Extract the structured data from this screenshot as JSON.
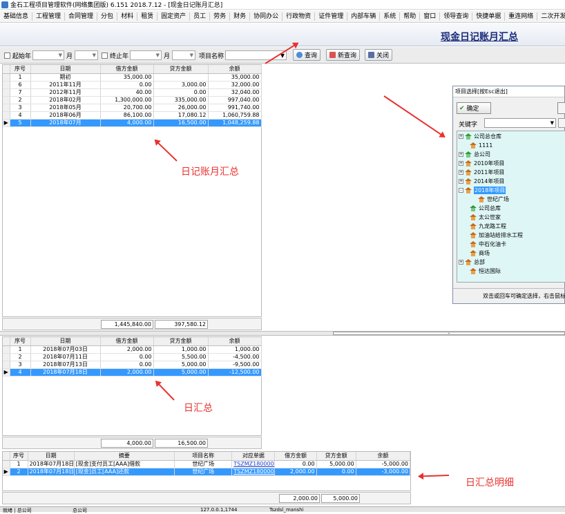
{
  "window": {
    "title": "金石工程项目管理软件(网络集团版) 6.151  2018.7.12 - [现金日记账月汇总]"
  },
  "menu": [
    "基础信息",
    "工程管理",
    "合同管理",
    "分包",
    "材料",
    "租赁",
    "固定资产",
    "员工",
    "劳务",
    "财务",
    "协同办公",
    "行政物资",
    "证件管理",
    "内部车辆",
    "系统",
    "帮助",
    "窗口",
    "领导查询",
    "快捷单据",
    "重连网络",
    "二次开发"
  ],
  "page_title": "现金日记账月汇总",
  "toolbar": {
    "start_year_label": "起始年",
    "start_month_label": "月",
    "end_year_label": "终止年",
    "end_month_label": "月",
    "project_label": "项目名称",
    "query_btn": "查询",
    "new_query_btn": "新查询",
    "close_btn": "关闭"
  },
  "monthly": {
    "headers": [
      "序号",
      "日期",
      "借方金额",
      "贷方金额",
      "余额"
    ],
    "rows": [
      [
        "1",
        "期初",
        "35,000.00",
        "",
        "35,000.00"
      ],
      [
        "6",
        "2011年11月",
        "0.00",
        "3,000.00",
        "32,000.00"
      ],
      [
        "7",
        "2012年11月",
        "40.00",
        "0.00",
        "32,040.00"
      ],
      [
        "2",
        "2018年02月",
        "1,300,000.00",
        "335,000.00",
        "997,040.00"
      ],
      [
        "3",
        "2018年05月",
        "20,700.00",
        "26,000.00",
        "991,740.00"
      ],
      [
        "4",
        "2018年06月",
        "86,100.00",
        "17,080.12",
        "1,060,759.88"
      ],
      [
        "5",
        "2018年07月",
        "4,000.00",
        "16,500.00",
        "1,048,259.88"
      ]
    ],
    "sum_debit": "1,445,840.00",
    "sum_credit": "397,580.12"
  },
  "daily": {
    "headers": [
      "序号",
      "日期",
      "借方金额",
      "贷方金额",
      "余额"
    ],
    "rows": [
      [
        "1",
        "2018年07月03日",
        "2,000.00",
        "1,000.00",
        "1,000.00"
      ],
      [
        "2",
        "2018年07月11日",
        "0.00",
        "5,500.00",
        "-4,500.00"
      ],
      [
        "3",
        "2018年07月13日",
        "0.00",
        "5,000.00",
        "-9,500.00"
      ],
      [
        "4",
        "2018年07月18日",
        "2,000.00",
        "5,000.00",
        "-12,500.00"
      ]
    ],
    "sum_debit": "4,000.00",
    "sum_credit": "16,500.00"
  },
  "detail": {
    "headers": [
      "序号",
      "日期",
      "摘要",
      "项目名称",
      "对应单据",
      "借方金额",
      "贷方金额",
      "余额"
    ],
    "rows": [
      [
        "1",
        "2018年07月18日",
        "[现金]支付员工[AAA]借款",
        "世纪广场",
        "TSZMZ180000005",
        "0.00",
        "5,000.00",
        "-5,000.00"
      ],
      [
        "2",
        "2018年07月18日",
        "[现金]员工[AAA]还款",
        "世纪广场",
        "TSZMZ180000005",
        "2,000.00",
        "0.00",
        "-3,000.00"
      ]
    ],
    "sum_debit": "2,000.00",
    "sum_credit": "5,000.00"
  },
  "annotations": {
    "monthly": "日记账月汇总",
    "daily": "日汇总",
    "detail": "日汇总明细"
  },
  "popup": {
    "title": "项目选择[按Esc退出]",
    "ok": "确定",
    "keyword_label": "关键字",
    "footer": "双击或回车可确定选择，右击鼠标",
    "tree": [
      {
        "label": "公司总仓库",
        "level": 0,
        "exp": "+",
        "green": true
      },
      {
        "label": "1111",
        "level": 1,
        "exp": "",
        "green": false
      },
      {
        "label": "总公司",
        "level": 0,
        "exp": "+",
        "green": true
      },
      {
        "label": "2010年项目",
        "level": 0,
        "exp": "+",
        "green": false
      },
      {
        "label": "2011年项目",
        "level": 0,
        "exp": "+",
        "green": false
      },
      {
        "label": "2014年项目",
        "level": 0,
        "exp": "+",
        "green": false
      },
      {
        "label": "2018年项目",
        "level": 0,
        "exp": "-",
        "green": false,
        "selected": true
      },
      {
        "label": "世纪广场",
        "level": 2,
        "exp": "",
        "green": false
      },
      {
        "label": "公司总库",
        "level": 1,
        "exp": "",
        "green": true
      },
      {
        "label": "太公世家",
        "level": 1,
        "exp": "",
        "green": false
      },
      {
        "label": "九龙路工程",
        "level": 1,
        "exp": "",
        "green": false
      },
      {
        "label": "加油站给排水工程",
        "level": 1,
        "exp": "",
        "green": false
      },
      {
        "label": "中石化油卡",
        "level": 1,
        "exp": "",
        "green": false
      },
      {
        "label": "商场",
        "level": 1,
        "exp": "",
        "green": false
      },
      {
        "label": "总部",
        "level": 0,
        "exp": "+",
        "green": false
      },
      {
        "label": "恒达国际",
        "level": 1,
        "exp": "",
        "green": false
      }
    ]
  },
  "status": [
    "就绪 | 总公司",
    "总公司",
    "127.0.0.1,1744",
    "Tszdsl_manshi"
  ]
}
